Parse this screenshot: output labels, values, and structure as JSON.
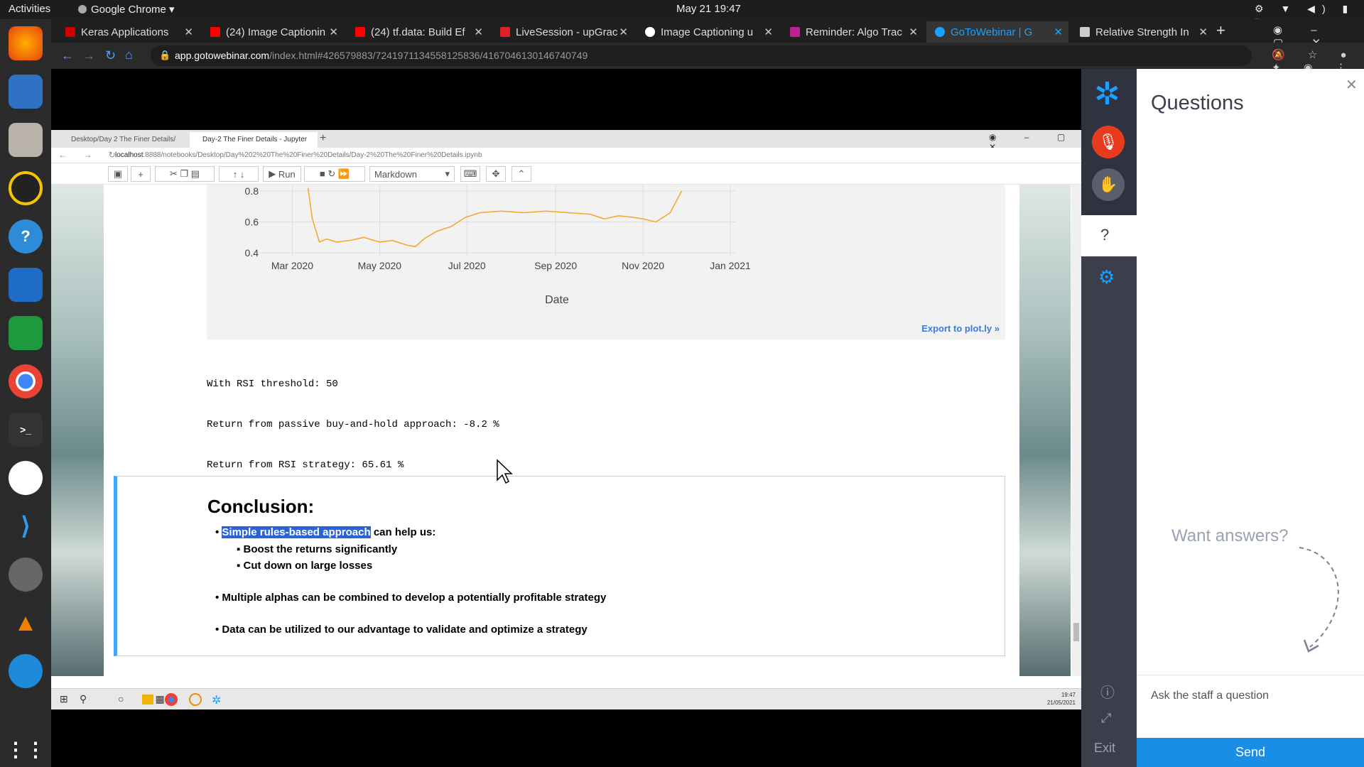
{
  "system": {
    "activities": "Activities",
    "app_menu": "Google Chrome",
    "clock": "May 21  19:47"
  },
  "chrome": {
    "tabs": [
      {
        "label": "Keras Applications",
        "color": "#d00000"
      },
      {
        "label": "(24) Image Captionin",
        "color": "#ff0000"
      },
      {
        "label": "(24) tf.data: Build Ef",
        "color": "#ff0000"
      },
      {
        "label": "LiveSession - upGrac",
        "color": "#e0202a"
      },
      {
        "label": "Image Captioning u",
        "color": "#ffffff"
      },
      {
        "label": "Reminder: Algo Trac",
        "color": "#c02090"
      },
      {
        "label": "GoToWebinar | G",
        "color": "#19a1ff"
      },
      {
        "label": "Relative Strength In",
        "color": "#cccccc"
      }
    ],
    "url_domain": "app.gotowebinar.com",
    "url_path": "/index.html#426579883/7241971134558125836/4167046130146740749"
  },
  "inner_browser": {
    "tabs": [
      "Desktop/Day 2 The Finer Details/",
      "Day-2 The Finer Details - Jupyter"
    ],
    "url_host": "localhost",
    "url_rest": ":8888/notebooks/Desktop/Day%202%20The%20Finer%20Details/Day-2%20The%20Finer%20Details.ipynb",
    "toolbar": {
      "run": "Run",
      "cell_type": "Markdown"
    }
  },
  "chart_data": {
    "type": "line",
    "xlabel": "Date",
    "x_ticks": [
      "Mar 2020",
      "May 2020",
      "Jul 2020",
      "Sep 2020",
      "Nov 2020",
      "Jan 2021"
    ],
    "y_ticks": [
      "0.4",
      "0.6",
      "0.8"
    ],
    "ylim": [
      0.4,
      0.8
    ],
    "series": [
      {
        "color": "#f5a623",
        "x": [
          "2020-03-12",
          "2020-03-15",
          "2020-03-20",
          "2020-03-25",
          "2020-04-01",
          "2020-04-10",
          "2020-04-20",
          "2020-05-01",
          "2020-05-10",
          "2020-05-20",
          "2020-05-26",
          "2020-06-01",
          "2020-06-10",
          "2020-06-20",
          "2020-06-30",
          "2020-07-10",
          "2020-07-25",
          "2020-08-10",
          "2020-08-25",
          "2020-09-10",
          "2020-09-25",
          "2020-10-05",
          "2020-10-15",
          "2020-10-25",
          "2020-11-01",
          "2020-11-10",
          "2020-11-20",
          "2020-11-28"
        ],
        "y": [
          0.82,
          0.62,
          0.47,
          0.49,
          0.47,
          0.48,
          0.5,
          0.47,
          0.48,
          0.45,
          0.44,
          0.49,
          0.54,
          0.57,
          0.63,
          0.66,
          0.67,
          0.66,
          0.67,
          0.66,
          0.65,
          0.62,
          0.64,
          0.63,
          0.62,
          0.6,
          0.66,
          0.8
        ]
      }
    ],
    "export_link": "Export to plot.ly »"
  },
  "output_text": [
    "With RSI threshold: 50",
    "Return from passive buy-and-hold approach: -8.2 %",
    "Return from RSI strategy: 65.61 %"
  ],
  "conclusion": {
    "heading": "Conclusion:",
    "b1_highlight": "Simple rules-based approach",
    "b1_rest": " can help us:",
    "sub1": "Boost the returns significantly",
    "sub2": "Cut down on large losses",
    "b2": "Multiple alphas can be combined to develop a potentially profitable strategy",
    "b3": "Data can be utilized to our advantage to validate and optimize a strategy"
  },
  "win_taskbar": {
    "time": "19:47",
    "date": "21/05/2021"
  },
  "gtw": {
    "title": "Questions",
    "want_answers": "Want answers?",
    "placeholder": "Ask the staff a question",
    "send": "Send",
    "exit": "Exit"
  }
}
